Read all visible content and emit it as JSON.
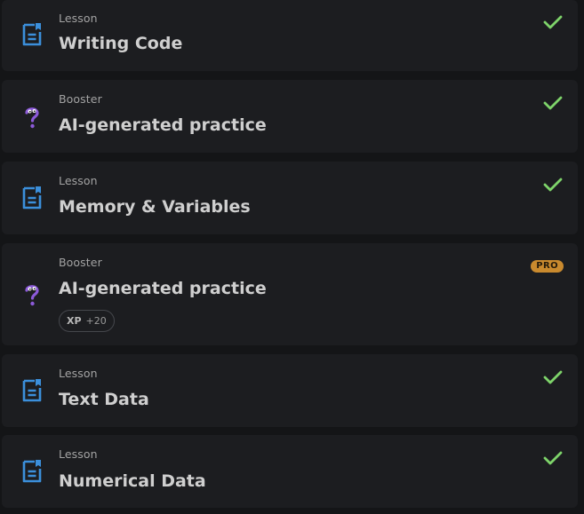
{
  "items": [
    {
      "type": "Lesson",
      "title": "Writing Code",
      "icon": "lesson-document-icon",
      "completed": true
    },
    {
      "type": "Booster",
      "title": "AI-generated practice",
      "icon": "question-mark-icon",
      "completed": true
    },
    {
      "type": "Lesson",
      "title": "Memory & Variables",
      "icon": "lesson-document-icon",
      "completed": true
    },
    {
      "type": "Booster",
      "title": "AI-generated practice",
      "icon": "question-mark-icon",
      "completed": false,
      "badge": "PRO",
      "xp_label": "XP",
      "xp_value": "+20"
    },
    {
      "type": "Lesson",
      "title": "Text Data",
      "icon": "lesson-document-icon",
      "completed": true
    },
    {
      "type": "Lesson",
      "title": "Numerical Data",
      "icon": "lesson-document-icon",
      "completed": true
    }
  ],
  "colors": {
    "lesson_icon": "#3b8fdb",
    "booster_icon": "#8c5ad9",
    "check": "#7ed46a",
    "pro_badge": "#c98a2e"
  }
}
